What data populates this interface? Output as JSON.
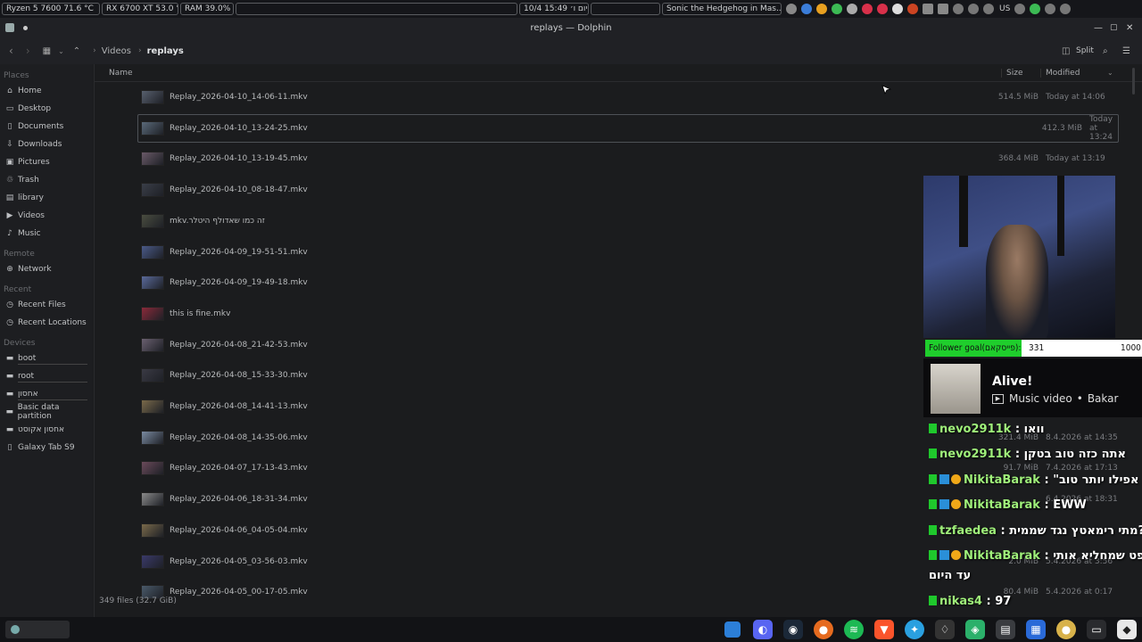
{
  "topbar": {
    "cpu": "Ryzen 5 7600  71.6 °C",
    "gpu": "RX 6700 XT  53.0 °C",
    "ram": "RAM   39.0%",
    "clock": "10/4 יום ו׳ 15:49",
    "media": "Sonic the Hedgehog in Mas...",
    "lang": "US"
  },
  "window": {
    "title": "replays — Dolphin"
  },
  "toolbar": {
    "breadcrumb": [
      "Videos",
      "replays"
    ],
    "split_label": "Split"
  },
  "sidebar": {
    "places_header": "Places",
    "places": [
      "Home",
      "Desktop",
      "Documents",
      "Downloads",
      "Pictures",
      "Trash",
      "library",
      "Videos",
      "Music"
    ],
    "remote_header": "Remote",
    "remote": [
      "Network"
    ],
    "recent_header": "Recent",
    "recent": [
      "Recent Files",
      "Recent Locations"
    ],
    "devices_header": "Devices",
    "devices": [
      "boot",
      "root",
      "אחסון",
      "Basic data partition",
      "אחסון אקוסט",
      "Galaxy Tab S9"
    ]
  },
  "columns": {
    "name": "Name",
    "size": "Size",
    "modified": "Modified"
  },
  "files": [
    {
      "name": "Replay_2026-04-10_14-06-11.mkv",
      "size": "514.5 MiB",
      "modified": "Today at 14:06"
    },
    {
      "name": "Replay_2026-04-10_13-24-25.mkv",
      "size": "412.3 MiB",
      "modified": "Today at 13:24"
    },
    {
      "name": "Replay_2026-04-10_13-19-45.mkv",
      "size": "368.4 MiB",
      "modified": "Today at 13:19"
    },
    {
      "name": "Replay_2026-04-10_08-18-47.mkv",
      "size": "",
      "modified": ""
    },
    {
      "name": "mkv.זה כמו שאדולף היטלר",
      "size": "",
      "modified": ""
    },
    {
      "name": "Replay_2026-04-09_19-51-51.mkv",
      "size": "",
      "modified": ""
    },
    {
      "name": "Replay_2026-04-09_19-49-18.mkv",
      "size": "",
      "modified": ""
    },
    {
      "name": "this is fine.mkv",
      "size": "",
      "modified": ""
    },
    {
      "name": "Replay_2026-04-08_21-42-53.mkv",
      "size": "",
      "modified": ""
    },
    {
      "name": "Replay_2026-04-08_15-33-30.mkv",
      "size": "",
      "modified": ""
    },
    {
      "name": "Replay_2026-04-08_14-41-13.mkv",
      "size": "",
      "modified": ""
    },
    {
      "name": "Replay_2026-04-08_14-35-06.mkv",
      "size": "321.4 MiB",
      "modified": "8.4.2026 at 14:35"
    },
    {
      "name": "Replay_2026-04-07_17-13-43.mkv",
      "size": "91.7 MiB",
      "modified": "7.4.2026 at 17:13"
    },
    {
      "name": "Replay_2026-04-06_18-31-34.mkv",
      "size": "",
      "modified": "6.4.2026 at 18:31"
    },
    {
      "name": "Replay_2026-04-06_04-05-04.mkv",
      "size": "",
      "modified": ""
    },
    {
      "name": "Replay_2026-04-05_03-56-03.mkv",
      "size": "2.0 MiB",
      "modified": "5.4.2026 at 3:56"
    },
    {
      "name": "Replay_2026-04-05_00-17-05.mkv",
      "size": "80.4 MiB",
      "modified": "5.4.2026 at 0:17"
    }
  ],
  "status": {
    "summary": "349 files (32.7 GiB)"
  },
  "stream": {
    "goal_label": "Follower goal(פייסקאם):",
    "goal_current": "331",
    "goal_target": "1000",
    "goal_progress": 0.331,
    "music_title": "Alive!",
    "music_kind": "Music video",
    "music_artist": "Bakar",
    "chat": [
      {
        "user": "nevo2911k",
        "msg": "וואו"
      },
      {
        "user": "nevo2911k",
        "msg": "אתה כזה טוב בטקן"
      },
      {
        "user": "NikitaBarak",
        "msg": "\"אפילו יותר טוב"
      },
      {
        "user": "NikitaBarak",
        "msg": "EWW"
      },
      {
        "user": "tzfaedea",
        "msg": "מתי רימאטץ נגד שממית?"
      },
      {
        "user": "NikitaBarak",
        "msg": "משפט שמחליא אותי"
      },
      {
        "user": "",
        "msg": "עד היום"
      },
      {
        "user": "nikas4",
        "msg": "97"
      }
    ]
  },
  "colors": {
    "goal_green": "#1fce2c",
    "accent_blue": "#3d8fd8"
  }
}
